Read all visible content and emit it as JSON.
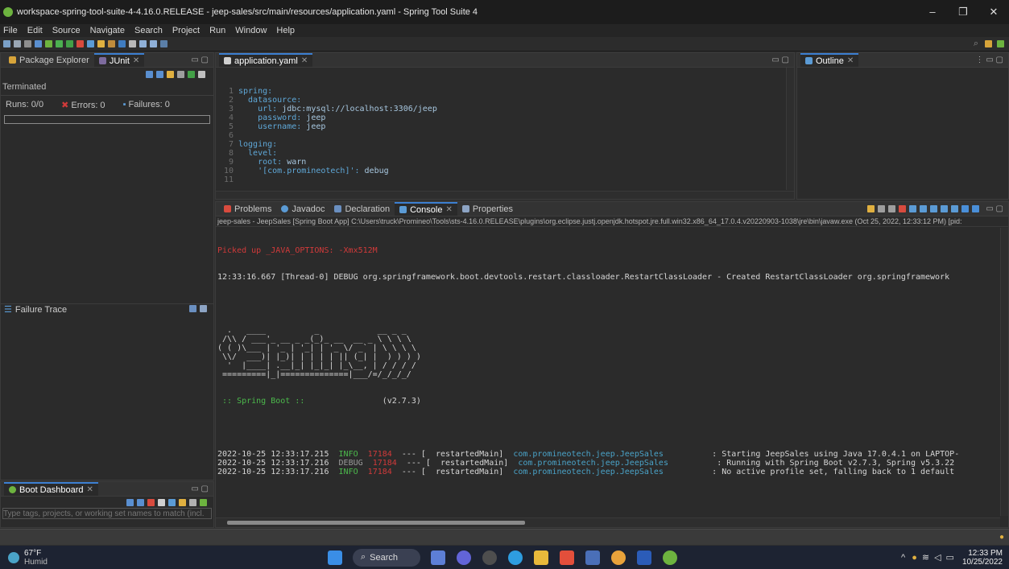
{
  "window": {
    "title": "workspace-spring-tool-suite-4-4.16.0.RELEASE - jeep-sales/src/main/resources/application.yaml - Spring Tool Suite 4",
    "minimize": "–",
    "maximize": "❐",
    "close": "✕"
  },
  "menu": [
    "File",
    "Edit",
    "Source",
    "Navigate",
    "Search",
    "Project",
    "Run",
    "Window",
    "Help"
  ],
  "left": {
    "tabs": [
      {
        "label": "Package Explorer"
      },
      {
        "label": "JUnit"
      }
    ],
    "junit": {
      "status": "Terminated",
      "runs": "Runs: 0/0",
      "errors": "Errors: 0",
      "failures": "Failures: 0",
      "failure_trace": "Failure Trace"
    },
    "boot_dashboard": {
      "title": "Boot Dashboard",
      "filter_placeholder": "Type tags, projects, or working set names to match (incl."
    }
  },
  "editor": {
    "tab": "application.yaml",
    "lines": [
      {
        "n": "1",
        "text": "spring:"
      },
      {
        "n": "2",
        "text": "  datasource:"
      },
      {
        "n": "3",
        "text": "    url: jdbc:mysql://localhost:3306/jeep"
      },
      {
        "n": "4",
        "text": "    password: jeep"
      },
      {
        "n": "5",
        "text": "    username: jeep"
      },
      {
        "n": "6",
        "text": ""
      },
      {
        "n": "7",
        "text": "logging:"
      },
      {
        "n": "8",
        "text": "  level:"
      },
      {
        "n": "9",
        "text": "    root: warn"
      },
      {
        "n": "10",
        "text": "    '[com.promineotech]': debug"
      },
      {
        "n": "11",
        "text": ""
      }
    ]
  },
  "outline": {
    "tab": "Outline"
  },
  "bottom": {
    "tabs": [
      {
        "label": "Problems"
      },
      {
        "label": "Javadoc"
      },
      {
        "label": "Declaration"
      },
      {
        "label": "Console"
      },
      {
        "label": "Properties"
      }
    ],
    "console_header": "jeep-sales - JeepSales [Spring Boot App] C:\\Users\\truck\\Promineo\\Tools\\sts-4.16.0.RELEASE\\plugins\\org.eclipse.justj.openjdk.hotspot.jre.full.win32.x86_64_17.0.4.v20220903-1038\\jre\\bin\\javaw.exe (Oct 25, 2022, 12:33:12 PM) [pid:",
    "picked_up": "Picked up _JAVA_OPTIONS: -Xmx512M",
    "debug_line": "12:33:16.667 [Thread-0] DEBUG org.springframework.boot.devtools.restart.classloader.RestartClassLoader - Created RestartClassLoader org.springframework",
    "banner": [
      "  .   ____          _            __ _ _",
      " /\\\\ / ___'_ __ _ _(_)_ __  __ _ \\ \\ \\ \\",
      "( ( )\\___ | '_ | '_| | '_ \\/ _` | \\ \\ \\ \\",
      " \\\\/  ___)| |_)| | | | | || (_| |  ) ) ) )",
      "  '  |____| .__|_| |_|_| |_\\__, | / / / /",
      " =========|_|==============|___/=/_/_/_/"
    ],
    "boot_label": " :: Spring Boot :: ",
    "boot_version": "               (v2.7.3)",
    "logs": [
      {
        "ts": "2022-10-25 12:33:17.215",
        "level": "INFO",
        "pid": "17184",
        "sep": "--- [  restartedMain]",
        "logger": "com.promineotech.jeep.JeepSales",
        "msg": ": Starting JeepSales using Java 17.0.4.1 on LAPTOP-"
      },
      {
        "ts": "2022-10-25 12:33:17.216",
        "level": "DEBUG",
        "pid": "17184",
        "sep": "--- [  restartedMain]",
        "logger": "com.promineotech.jeep.JeepSales",
        "msg": ": Running with Spring Boot v2.7.3, Spring v5.3.22"
      },
      {
        "ts": "2022-10-25 12:33:17.216",
        "level": "INFO",
        "pid": "17184",
        "sep": "--- [  restartedMain]",
        "logger": "com.promineotech.jeep.JeepSales",
        "msg": ": No active profile set, falling back to 1 default"
      }
    ]
  },
  "taskbar": {
    "weather_temp": "67°F",
    "weather_desc": "Humid",
    "search": "Search",
    "time": "12:33 PM",
    "date": "10/25/2022"
  },
  "colors": {
    "accent": "#3c7fd1",
    "spring_green": "#6db33f",
    "error_red": "#d23a3a",
    "log_blue": "#4aa3c8"
  }
}
